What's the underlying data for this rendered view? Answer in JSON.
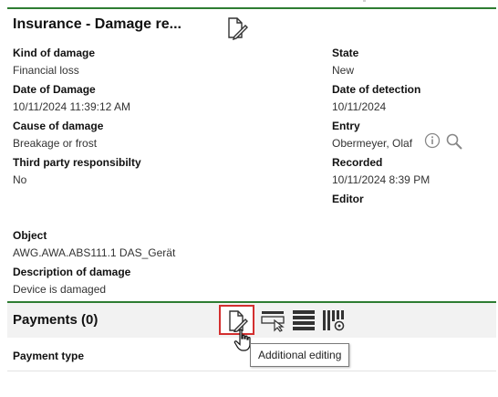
{
  "header": {
    "title": "Insurance - Damage re..."
  },
  "details": {
    "kind_of_damage": {
      "label": "Kind of damage",
      "value": "Financial loss"
    },
    "date_of_damage": {
      "label": "Date of Damage",
      "value": "10/11/2024 11:39:12 AM"
    },
    "cause_of_damage": {
      "label": "Cause of damage",
      "value": "Breakage or frost"
    },
    "third_party": {
      "label": "Third party responsibilty",
      "value": "No"
    },
    "state": {
      "label": "State",
      "value": "New"
    },
    "date_of_detection": {
      "label": "Date of detection",
      "value": "10/11/2024"
    },
    "entry": {
      "label": "Entry",
      "value": "Obermeyer, Olaf"
    },
    "recorded": {
      "label": "Recorded",
      "value": "10/11/2024 8:39 PM"
    },
    "editor": {
      "label": "Editor",
      "value": ""
    },
    "object": {
      "label": "Object",
      "value": "AWG.AWA.ABS111.1 DAS_Gerät"
    },
    "description": {
      "label": "Description of damage",
      "value": "Device is damaged"
    }
  },
  "payments": {
    "title": "Payments (0)",
    "columns": [
      "Payment type"
    ],
    "tooltip": "Additional editing"
  },
  "icons": {
    "title_edit": "edit-document-icon",
    "info": "info-icon",
    "search": "search-icon",
    "toolbar": [
      "edit-document-icon",
      "select-row-icon",
      "list-view-icon",
      "column-settings-icon"
    ],
    "cursor": "hand-pointer-icon"
  },
  "colors": {
    "accent_rule": "#2e7d32",
    "highlight_border": "#d32f2f",
    "toolbar_icon": "#333333"
  }
}
